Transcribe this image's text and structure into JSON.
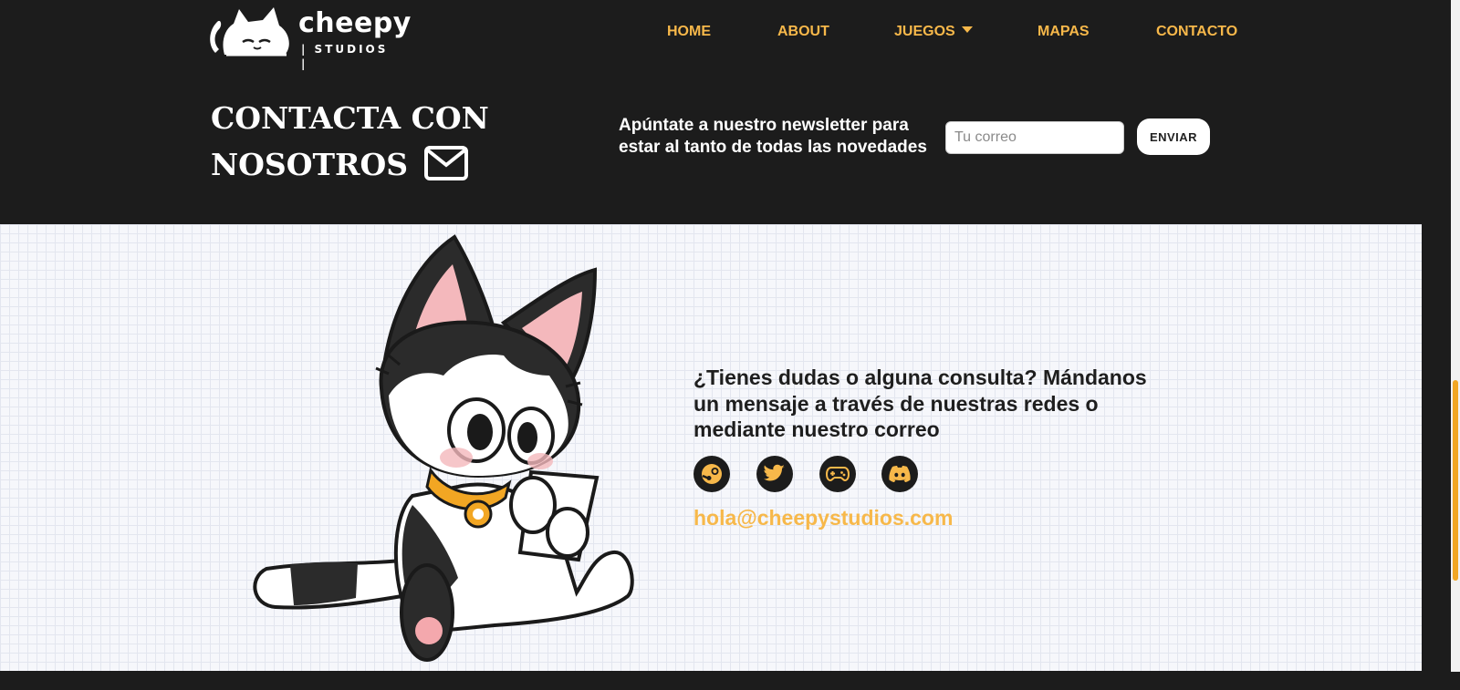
{
  "logo": {
    "brand": "cheepy",
    "sub": "| STUDIOS |"
  },
  "nav": {
    "items": [
      {
        "label": "HOME"
      },
      {
        "label": "ABOUT"
      },
      {
        "label": "JUEGOS"
      },
      {
        "label": "MAPAS"
      },
      {
        "label": "CONTACTO"
      }
    ]
  },
  "contact": {
    "title_line1": "CONTACTA CON",
    "title_line2": "NOSOTROS"
  },
  "newsletter": {
    "text": "Apúntate a nuestro newsletter para estar al tanto de todas las novedades",
    "placeholder": "Tu correo",
    "button_label": "ENVIAR"
  },
  "main": {
    "question": "¿Tienes dudas o alguna consulta? Mándanos un mensaje a través de nuestras redes o mediante nuestro correo",
    "email": "hola@cheepystudios.com",
    "socials": [
      {
        "icon": "steam-icon"
      },
      {
        "icon": "twitter-icon"
      },
      {
        "icon": "gamepad-icon"
      },
      {
        "icon": "discord-icon"
      }
    ]
  },
  "colors": {
    "accent": "#f7b84a",
    "dark": "#1c1c1c"
  }
}
